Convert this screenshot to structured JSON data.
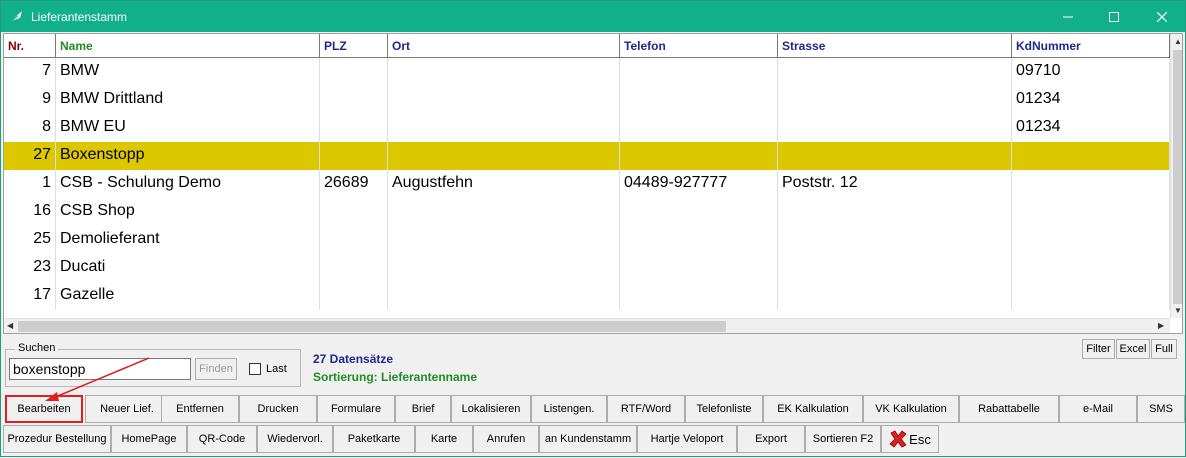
{
  "window": {
    "title": "Lieferantenstamm"
  },
  "grid": {
    "columns": [
      "Nr.",
      "Name",
      "PLZ",
      "Ort",
      "Telefon",
      "Strasse",
      "KdNummer"
    ],
    "rows": [
      {
        "nr": "7",
        "name": "BMW",
        "plz": "",
        "ort": "",
        "telefon": "",
        "strasse": "",
        "kdnummer": "09710"
      },
      {
        "nr": "9",
        "name": "BMW Drittland",
        "plz": "",
        "ort": "",
        "telefon": "",
        "strasse": "",
        "kdnummer": "01234"
      },
      {
        "nr": "8",
        "name": "BMW EU",
        "plz": "",
        "ort": "",
        "telefon": "",
        "strasse": "",
        "kdnummer": "01234"
      },
      {
        "nr": "27",
        "name": "Boxenstopp",
        "plz": "",
        "ort": "",
        "telefon": "",
        "strasse": "",
        "kdnummer": "",
        "selected": true
      },
      {
        "nr": "1",
        "name": "CSB - Schulung Demo",
        "plz": "26689",
        "ort": "Augustfehn",
        "telefon": "04489-927777",
        "strasse": "Poststr. 12",
        "kdnummer": ""
      },
      {
        "nr": "16",
        "name": "CSB Shop",
        "plz": "",
        "ort": "",
        "telefon": "",
        "strasse": "",
        "kdnummer": ""
      },
      {
        "nr": "25",
        "name": "Demolieferant",
        "plz": "",
        "ort": "",
        "telefon": "",
        "strasse": "",
        "kdnummer": ""
      },
      {
        "nr": "23",
        "name": "Ducati",
        "plz": "",
        "ort": "",
        "telefon": "",
        "strasse": "",
        "kdnummer": ""
      },
      {
        "nr": "17",
        "name": "Gazelle",
        "plz": "",
        "ort": "",
        "telefon": "",
        "strasse": "",
        "kdnummer": ""
      }
    ]
  },
  "search": {
    "legend": "Suchen",
    "value": "boxenstopp",
    "find_label": "Finden",
    "last_label": "Last"
  },
  "status": {
    "count": "27 Datensätze",
    "sort": "Sortierung: Lieferantenname"
  },
  "view_buttons": [
    "Filter",
    "Excel",
    "Full"
  ],
  "toolbar_row1": [
    "Bearbeiten",
    "Neuer Lief.",
    "Entfernen",
    "Drucken",
    "Formulare",
    "Brief",
    "Lokalisieren",
    "Listengen.",
    "RTF/Word",
    "Telefonliste",
    "EK Kalkulation",
    "VK Kalkulation",
    "Rabattabelle",
    "e-Mail",
    "SMS"
  ],
  "toolbar_row2": [
    "Prozedur Bestellung",
    "HomePage",
    "QR-Code",
    "Wiedervorl.",
    "Paketkarte",
    "Karte",
    "Anrufen",
    "an Kundenstamm",
    "Hartje Veloport",
    "Export",
    "Sortieren F2",
    "Esc"
  ],
  "colors": {
    "titlebar": "#12b08a",
    "selected_row": "#dcc800",
    "count_text": "#1c2a8c",
    "sort_text": "#208c24",
    "annotation": "#e02020"
  },
  "icons": {
    "app": "leaf-icon",
    "esc": "red-x-icon"
  }
}
